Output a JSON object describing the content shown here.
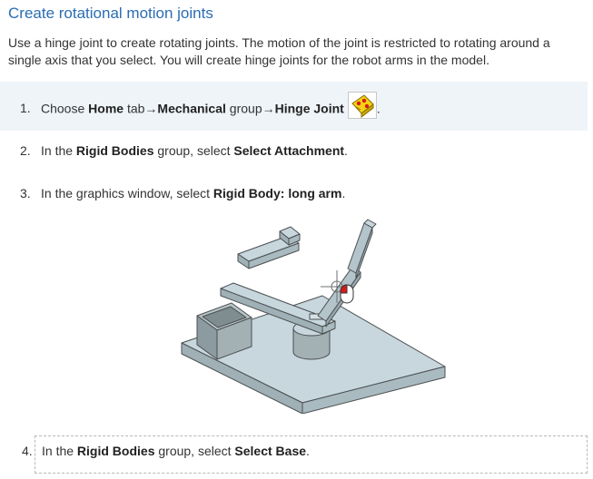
{
  "title": "Create rotational motion joints",
  "intro": "Use a hinge joint to create rotating joints. The motion of the joint is restricted to rotating around a single axis that you select. You will create hinge joints for the robot arms in the model.",
  "steps": [
    {
      "num": "1.",
      "parts": {
        "a": "Choose ",
        "b": "Home",
        "c": " tab",
        "d": "→",
        "e": "Mechanical",
        "f": " group",
        "g": "→",
        "h": "Hinge Joint",
        "i": "."
      }
    },
    {
      "num": "2.",
      "parts": {
        "a": "In the ",
        "b": "Rigid Bodies",
        "c": " group, select ",
        "d": "Select Attachment",
        "e": "."
      }
    },
    {
      "num": "3.",
      "parts": {
        "a": "In the graphics window, select ",
        "b": "Rigid Body: long arm",
        "c": "."
      }
    },
    {
      "num": "4.",
      "parts": {
        "a": "In the ",
        "b": "Rigid Bodies",
        "c": " group, select ",
        "d": "Select Base",
        "e": "."
      }
    }
  ],
  "icons": {
    "step1_icon": "hinge-joint-icon",
    "figure_cursor": "mouse-cursor-icon"
  },
  "colors": {
    "title": "#2a6db3",
    "highlight_bg": "#eef4f8",
    "model_face": "#c7d7dd",
    "model_edge": "#4b4f51"
  }
}
